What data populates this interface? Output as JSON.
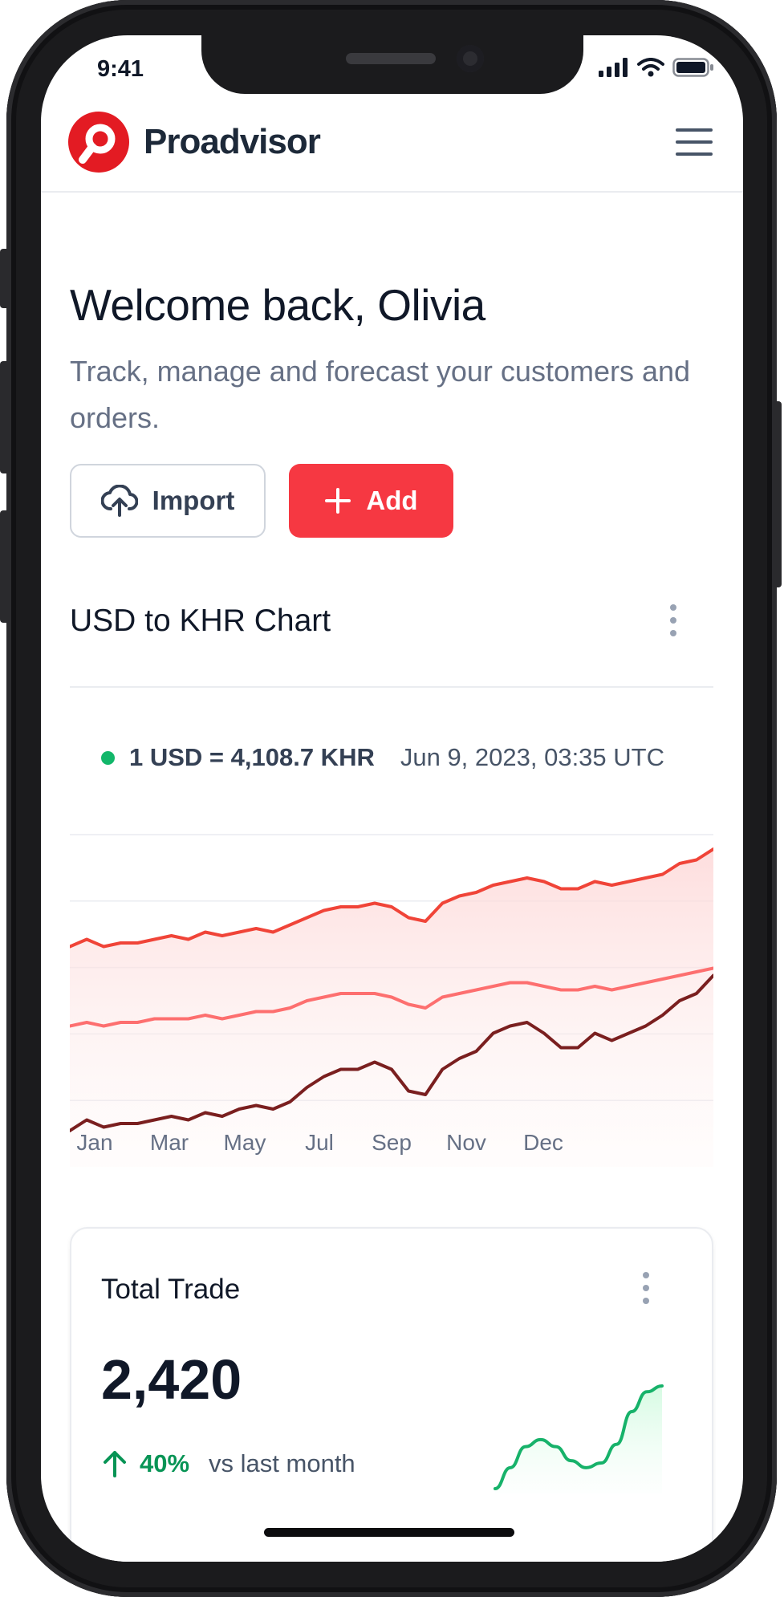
{
  "status_bar": {
    "time": "9:41"
  },
  "brand": {
    "name": "Proadvisor",
    "accent": "#e31b23"
  },
  "welcome": {
    "title": "Welcome back, Olivia",
    "subtitle": "Track, manage and forecast your customers and orders."
  },
  "actions": {
    "import_label": "Import",
    "add_label": "Add",
    "add_color": "#f63842"
  },
  "exchange": {
    "title": "USD to KHR Chart",
    "rate": "1 USD = 4,108.7 KHR",
    "timestamp": "Jun 9, 2023, 03:35 UTC"
  },
  "chart_data": {
    "type": "area",
    "title": "USD to KHR Chart",
    "x_labels": [
      "Jan",
      "Mar",
      "May",
      "Jul",
      "Sep",
      "Nov",
      "Dec"
    ],
    "ylim": [
      0,
      100
    ],
    "grid": "horizontal",
    "legend": "none",
    "series": [
      {
        "color": "#f04438",
        "fill": "area",
        "values": [
          61,
          63,
          61,
          62,
          62,
          63,
          64,
          63,
          65,
          64,
          65,
          66,
          65,
          67,
          69,
          71,
          72,
          72,
          73,
          72,
          69,
          68,
          73,
          75,
          76,
          78,
          79,
          80,
          79,
          77,
          77,
          79,
          78,
          79,
          80,
          81,
          84,
          85,
          88
        ]
      },
      {
        "color": "#fd6f6f",
        "values": [
          39,
          40,
          39,
          40,
          40,
          41,
          41,
          41,
          42,
          41,
          42,
          43,
          43,
          44,
          46,
          47,
          48,
          48,
          48,
          47,
          45,
          44,
          47,
          48,
          49,
          50,
          51,
          51,
          50,
          49,
          49,
          50,
          49,
          50,
          51,
          52,
          53,
          54,
          55
        ]
      },
      {
        "color": "#7a1f1f",
        "values": [
          10,
          13,
          11,
          12,
          12,
          13,
          14,
          13,
          15,
          14,
          16,
          17,
          16,
          18,
          22,
          25,
          27,
          27,
          29,
          27,
          21,
          20,
          27,
          30,
          32,
          37,
          39,
          40,
          37,
          33,
          33,
          37,
          35,
          37,
          39,
          42,
          46,
          48,
          53
        ]
      }
    ]
  },
  "total_trade": {
    "title": "Total Trade",
    "value": "2,420",
    "change": "40%",
    "change_label": "vs last month",
    "positive_color": "#079455",
    "spark": {
      "type": "area",
      "values": [
        2,
        20,
        38,
        44,
        38,
        26,
        20,
        24,
        40,
        68,
        85,
        90
      ]
    }
  }
}
